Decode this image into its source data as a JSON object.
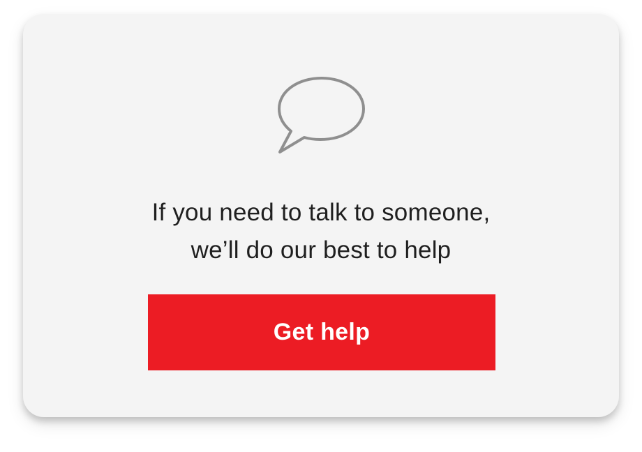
{
  "card": {
    "icon": "speech-bubble-icon",
    "message_line_1": "If you need to talk to someone,",
    "message_line_2": "we’ll do our best to help",
    "button_label": "Get help"
  },
  "colors": {
    "card_background": "#f4f4f4",
    "text": "#1f1f1f",
    "button_background": "#ec1c24",
    "button_text": "#ffffff",
    "icon_stroke": "#8f8f8f"
  }
}
